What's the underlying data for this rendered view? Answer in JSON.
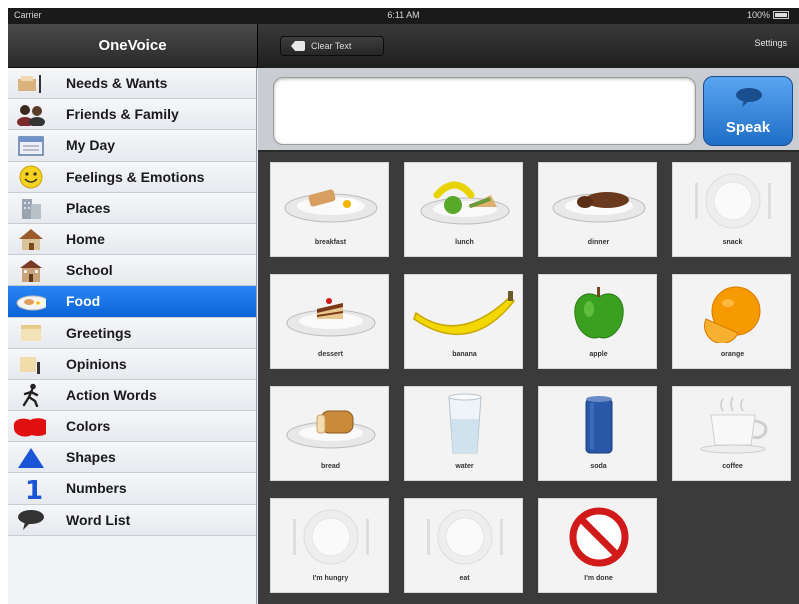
{
  "status_bar": {
    "carrier": "Carrier",
    "time": "6:11 AM",
    "battery": "100%"
  },
  "sidebar": {
    "title": "OneVoice",
    "items": [
      {
        "label": "Needs & Wants",
        "icon": "needs-icon"
      },
      {
        "label": "Friends & Family",
        "icon": "people-icon"
      },
      {
        "label": "My Day",
        "icon": "calendar-icon"
      },
      {
        "label": "Feelings & Emotions",
        "icon": "smiley-icon"
      },
      {
        "label": "Places",
        "icon": "building-icon"
      },
      {
        "label": "Home",
        "icon": "house-icon"
      },
      {
        "label": "School",
        "icon": "school-icon"
      },
      {
        "label": "Food",
        "icon": "plate-icon",
        "selected": true
      },
      {
        "label": "Greetings",
        "icon": "greetings-icon"
      },
      {
        "label": "Opinions",
        "icon": "opinions-icon"
      },
      {
        "label": "Action Words",
        "icon": "running-person-icon"
      },
      {
        "label": "Colors",
        "icon": "red-blob-icon"
      },
      {
        "label": "Shapes",
        "icon": "triangle-icon"
      },
      {
        "label": "Numbers",
        "icon": "number-one-icon"
      },
      {
        "label": "Word List",
        "icon": "speech-bubble-icon"
      }
    ]
  },
  "toolbar": {
    "clear_label": "Clear Text",
    "settings_label": "Settings"
  },
  "message": {
    "text": "",
    "placeholder": ""
  },
  "speak_label": "Speak",
  "tiles": [
    {
      "label": "breakfast",
      "icon": "breakfast-plate-icon"
    },
    {
      "label": "lunch",
      "icon": "lunch-plate-icon"
    },
    {
      "label": "dinner",
      "icon": "dinner-plate-icon"
    },
    {
      "label": "snack",
      "icon": "empty-plate-icon"
    },
    {
      "label": "dessert",
      "icon": "cake-icon"
    },
    {
      "label": "banana",
      "icon": "banana-icon"
    },
    {
      "label": "apple",
      "icon": "apple-icon"
    },
    {
      "label": "orange",
      "icon": "orange-icon"
    },
    {
      "label": "bread",
      "icon": "bread-icon"
    },
    {
      "label": "water",
      "icon": "water-glass-icon"
    },
    {
      "label": "soda",
      "icon": "soda-can-icon"
    },
    {
      "label": "coffee",
      "icon": "coffee-cup-icon"
    },
    {
      "label": "I'm hungry",
      "icon": "empty-plate-icon"
    },
    {
      "label": "eat",
      "icon": "empty-plate-icon"
    },
    {
      "label": "I'm done",
      "icon": "prohibited-icon"
    }
  ],
  "colors": {
    "selected": "#0b63d6",
    "speak": "#1f6fc8",
    "grid_bg": "#3b3b3b"
  }
}
